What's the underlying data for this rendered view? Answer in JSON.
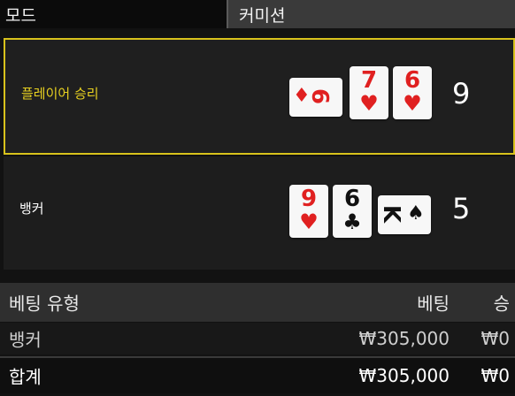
{
  "tabs": {
    "mode": "모드",
    "commission": "커미션"
  },
  "player": {
    "label": "플레이어 승리",
    "score": "9",
    "cards": [
      {
        "rank": "9",
        "suit": "♦",
        "color": "red"
      },
      {
        "rank": "7",
        "suit": "♥",
        "color": "red"
      },
      {
        "rank": "6",
        "suit": "♥",
        "color": "red"
      }
    ]
  },
  "banker": {
    "label": "뱅커",
    "score": "5",
    "cards": [
      {
        "rank": "9",
        "suit": "♥",
        "color": "red"
      },
      {
        "rank": "6",
        "suit": "♣",
        "color": "black"
      },
      {
        "rank": "K",
        "suit": "♠",
        "color": "black"
      }
    ]
  },
  "bet_table": {
    "headers": {
      "type": "베팅 유형",
      "bet": "베팅",
      "win": "승"
    },
    "rows": [
      {
        "type": "뱅커",
        "bet": "₩305,000",
        "win": "₩0"
      }
    ],
    "total": {
      "type": "합계",
      "bet": "₩305,000",
      "win": "₩0"
    }
  },
  "colors": {
    "winner_border": "#d8c21c",
    "red_suit": "#e02020",
    "black_suit": "#111111"
  }
}
